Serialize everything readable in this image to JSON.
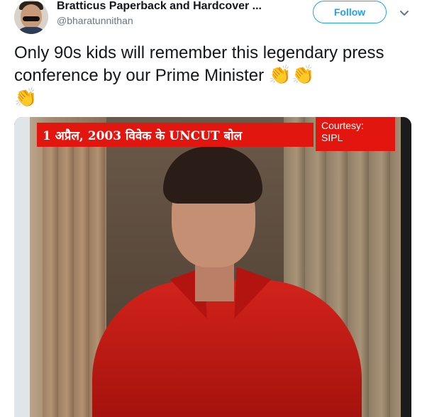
{
  "tweet": {
    "author_name": "Bratticus Paperback and Hardcover ...",
    "author_handle": "@bharatunnithan",
    "follow_label": "Follow",
    "text": "Only 90s kids will remember this legendary press conference by our Prime Minister",
    "emojis": [
      "👏",
      "👏",
      "👏"
    ]
  },
  "media": {
    "banner_text": "1 अप्रैल, 2003 विवेक के UNCUT बोल",
    "courtesy_label": "Courtesy:",
    "courtesy_source": "SIPL"
  },
  "icons": {
    "avatar": "avatar-photo",
    "menu": "chevron-down-icon"
  },
  "colors": {
    "accent": "#1da1f2",
    "text": "#14171a",
    "muted": "#657786",
    "banner_red": "#e3150f"
  }
}
